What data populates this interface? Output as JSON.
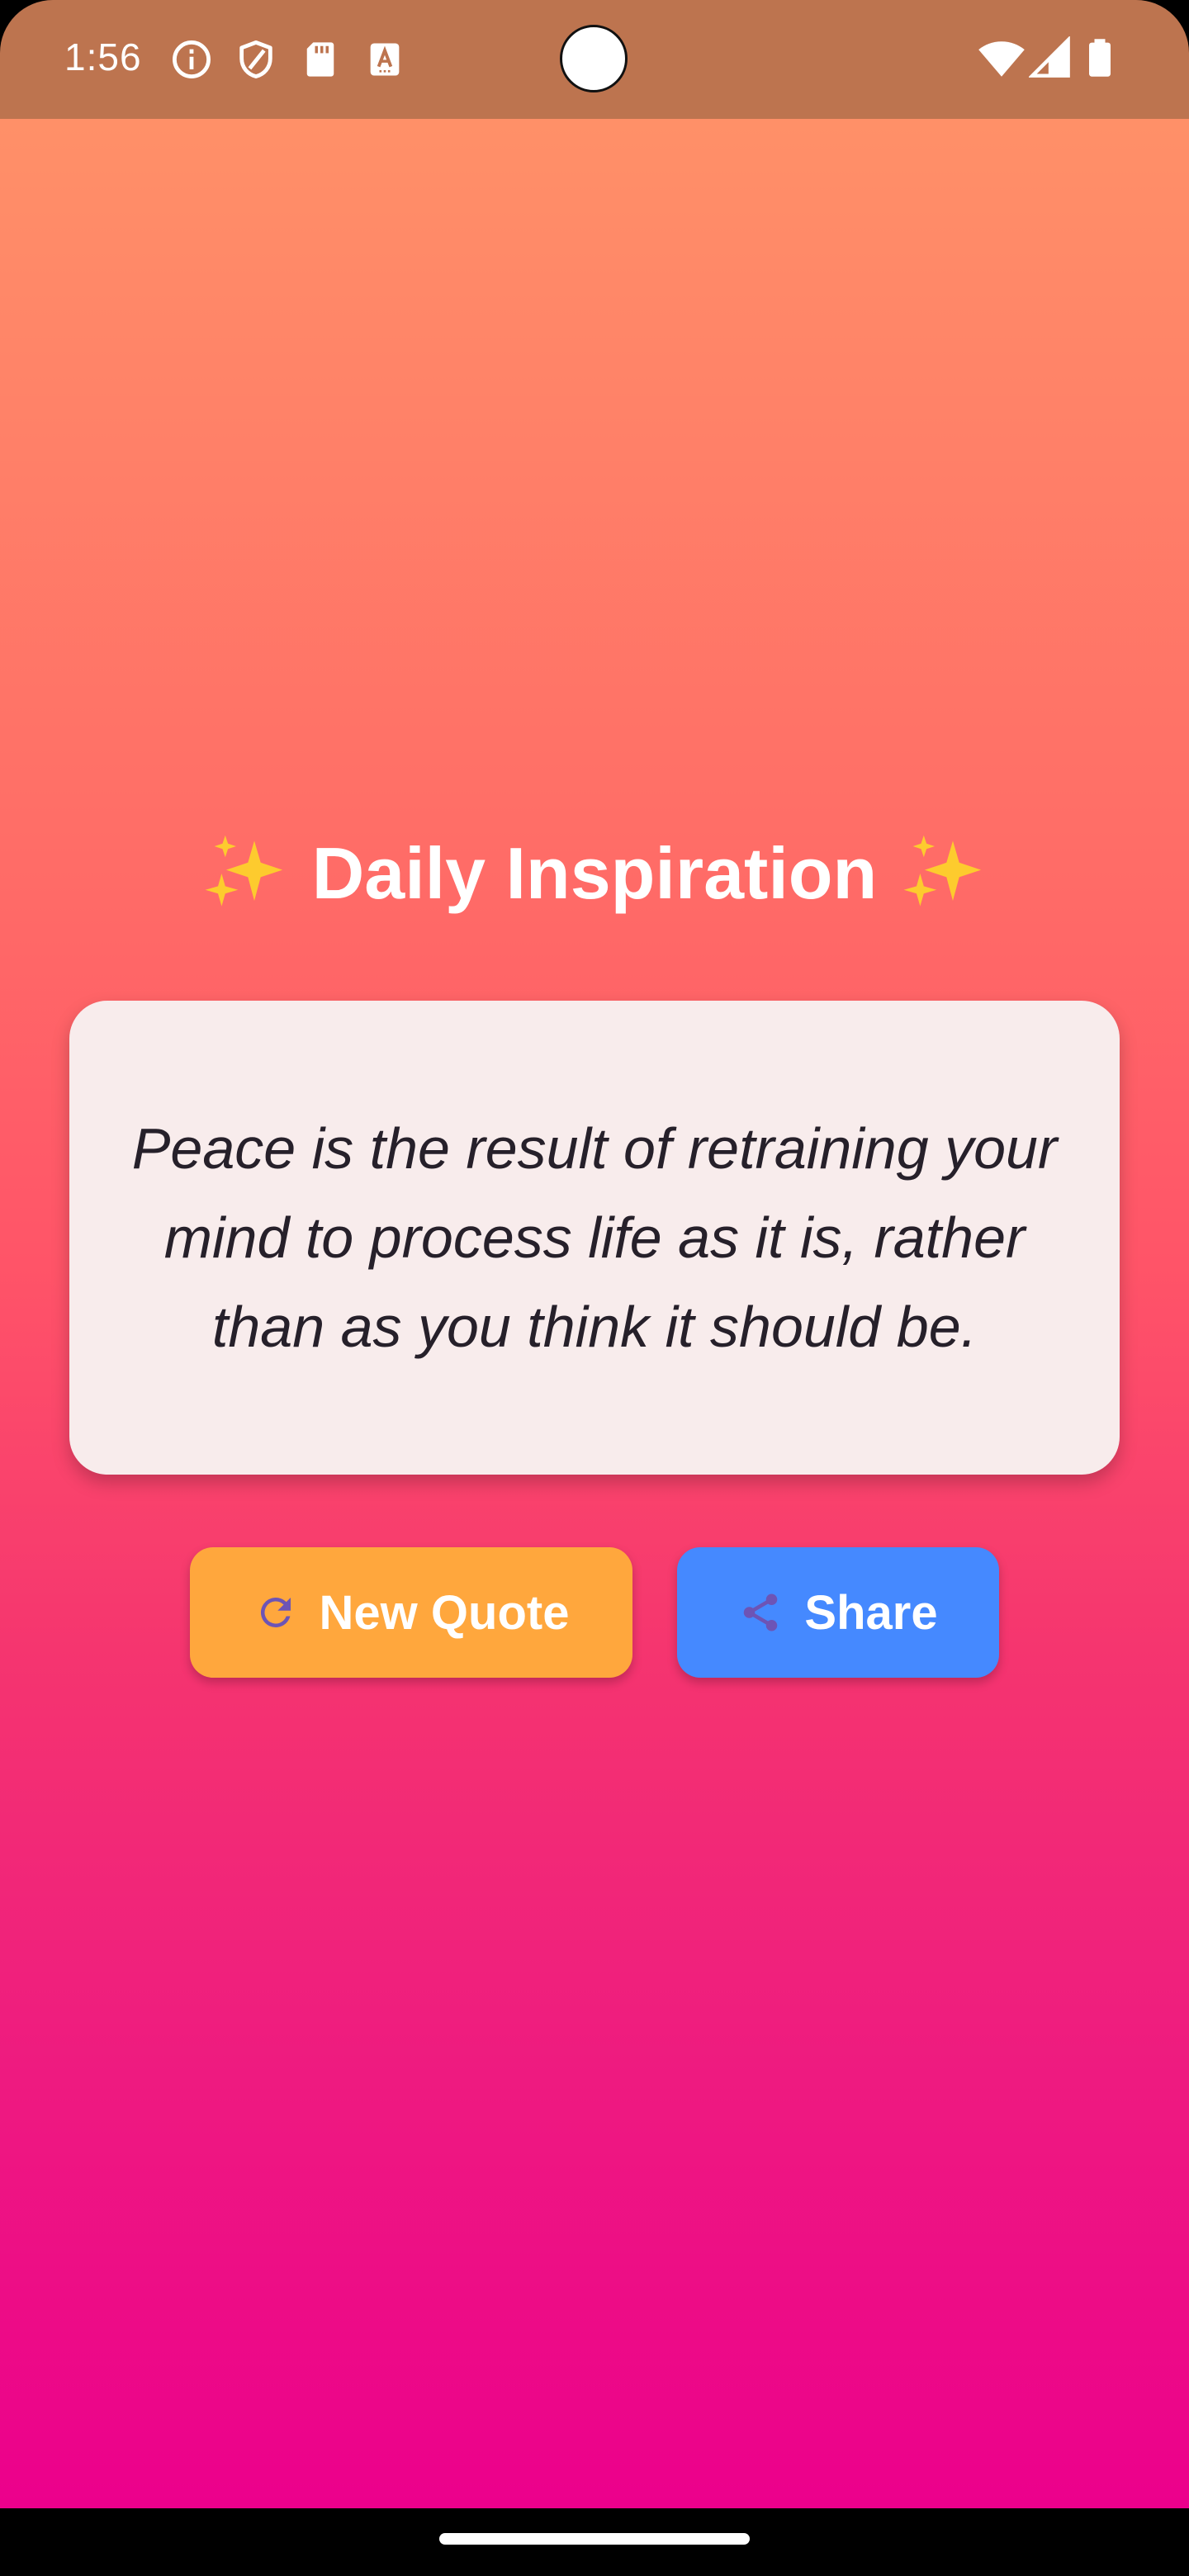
{
  "status_bar": {
    "time": "1:56",
    "left_icons": [
      "info-icon",
      "shield-icon",
      "sd-card-icon",
      "font-icon"
    ],
    "right_icons": [
      "wifi-icon",
      "cell-signal-icon",
      "battery-icon"
    ],
    "background_color": "#bd744f"
  },
  "app": {
    "title": "Daily Inspiration",
    "title_decoration": "✨",
    "quote": "Peace is the result of retraining your mind to process life as it is, rather than as you think it should be.",
    "gradient": {
      "top": "#ff9068",
      "bottom": "#ec008c"
    }
  },
  "buttons": {
    "new_quote": {
      "label": "New Quote",
      "icon": "refresh-icon",
      "color": "#ffa73d"
    },
    "share": {
      "label": "Share",
      "icon": "share-icon",
      "color": "#4589ff"
    }
  }
}
